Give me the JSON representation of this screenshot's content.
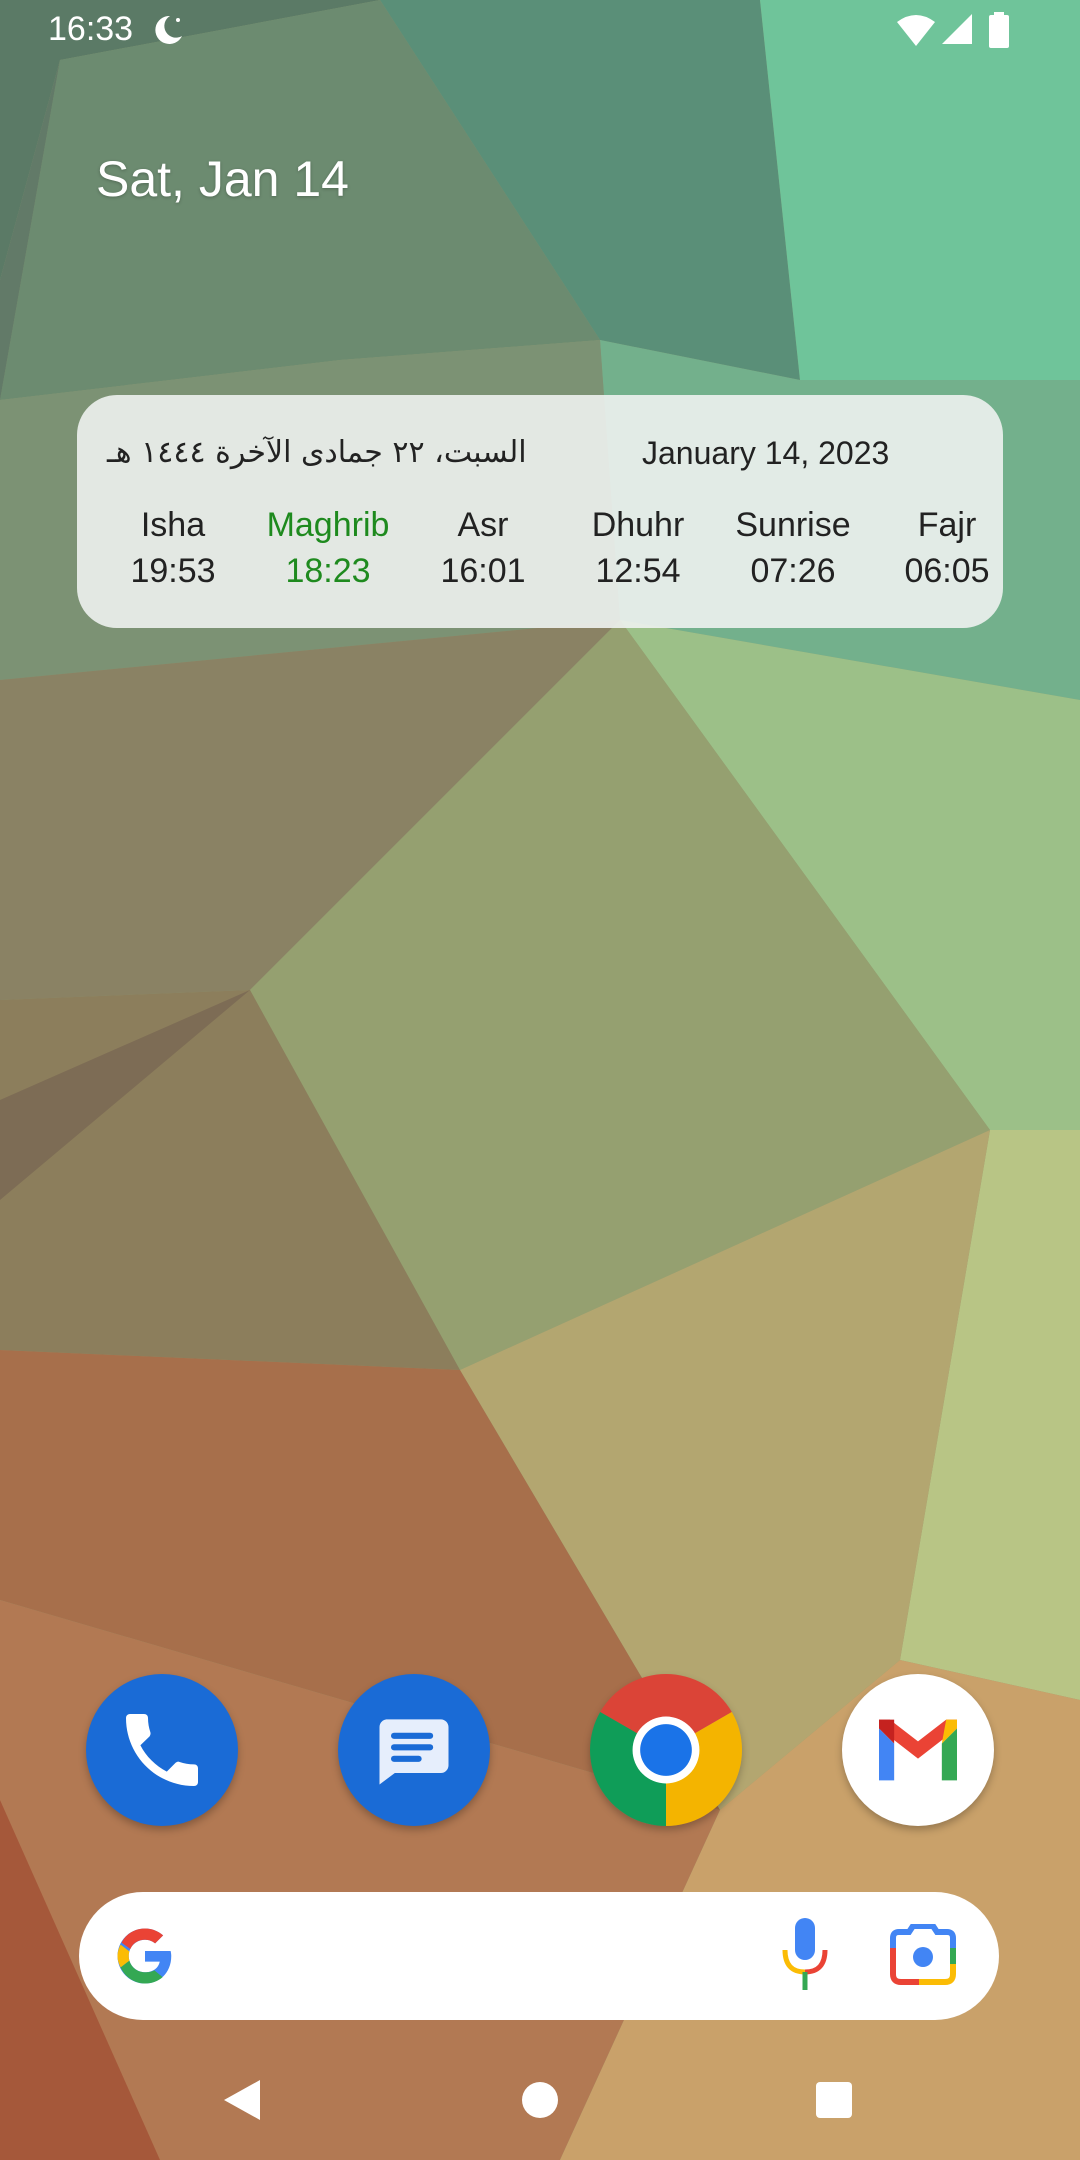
{
  "status_bar": {
    "time": "16:33",
    "icons": [
      "crescent-moon-icon",
      "wifi-icon",
      "cellular-signal-icon",
      "battery-icon"
    ]
  },
  "home": {
    "date": "Sat, Jan 14"
  },
  "prayer_widget": {
    "hijri_date": "السبت، ٢٢ جمادى الآخرة ١٤٤٤ هـ",
    "gregorian_date": "January 14, 2023",
    "active_color": "#1e8a1e",
    "prayers": [
      {
        "name": "Isha",
        "time": "19:53"
      },
      {
        "name": "Maghrib",
        "time": "18:23"
      },
      {
        "name": "Asr",
        "time": "16:01"
      },
      {
        "name": "Dhuhr",
        "time": "12:54"
      },
      {
        "name": "Sunrise",
        "time": "07:26"
      },
      {
        "name": "Fajr",
        "time": "06:05"
      }
    ]
  },
  "dock": {
    "apps": [
      {
        "icon": "phone-icon",
        "color": "#1a6bd6"
      },
      {
        "icon": "messages-icon",
        "color": "#1a6bd6"
      },
      {
        "icon": "chrome-icon"
      },
      {
        "icon": "gmail-icon"
      }
    ]
  },
  "search_bar": {
    "icons": [
      "google-g-icon",
      "microphone-icon",
      "google-lens-icon"
    ]
  },
  "nav_bar": {
    "icons": [
      "back-icon",
      "home-icon",
      "recents-icon"
    ]
  }
}
